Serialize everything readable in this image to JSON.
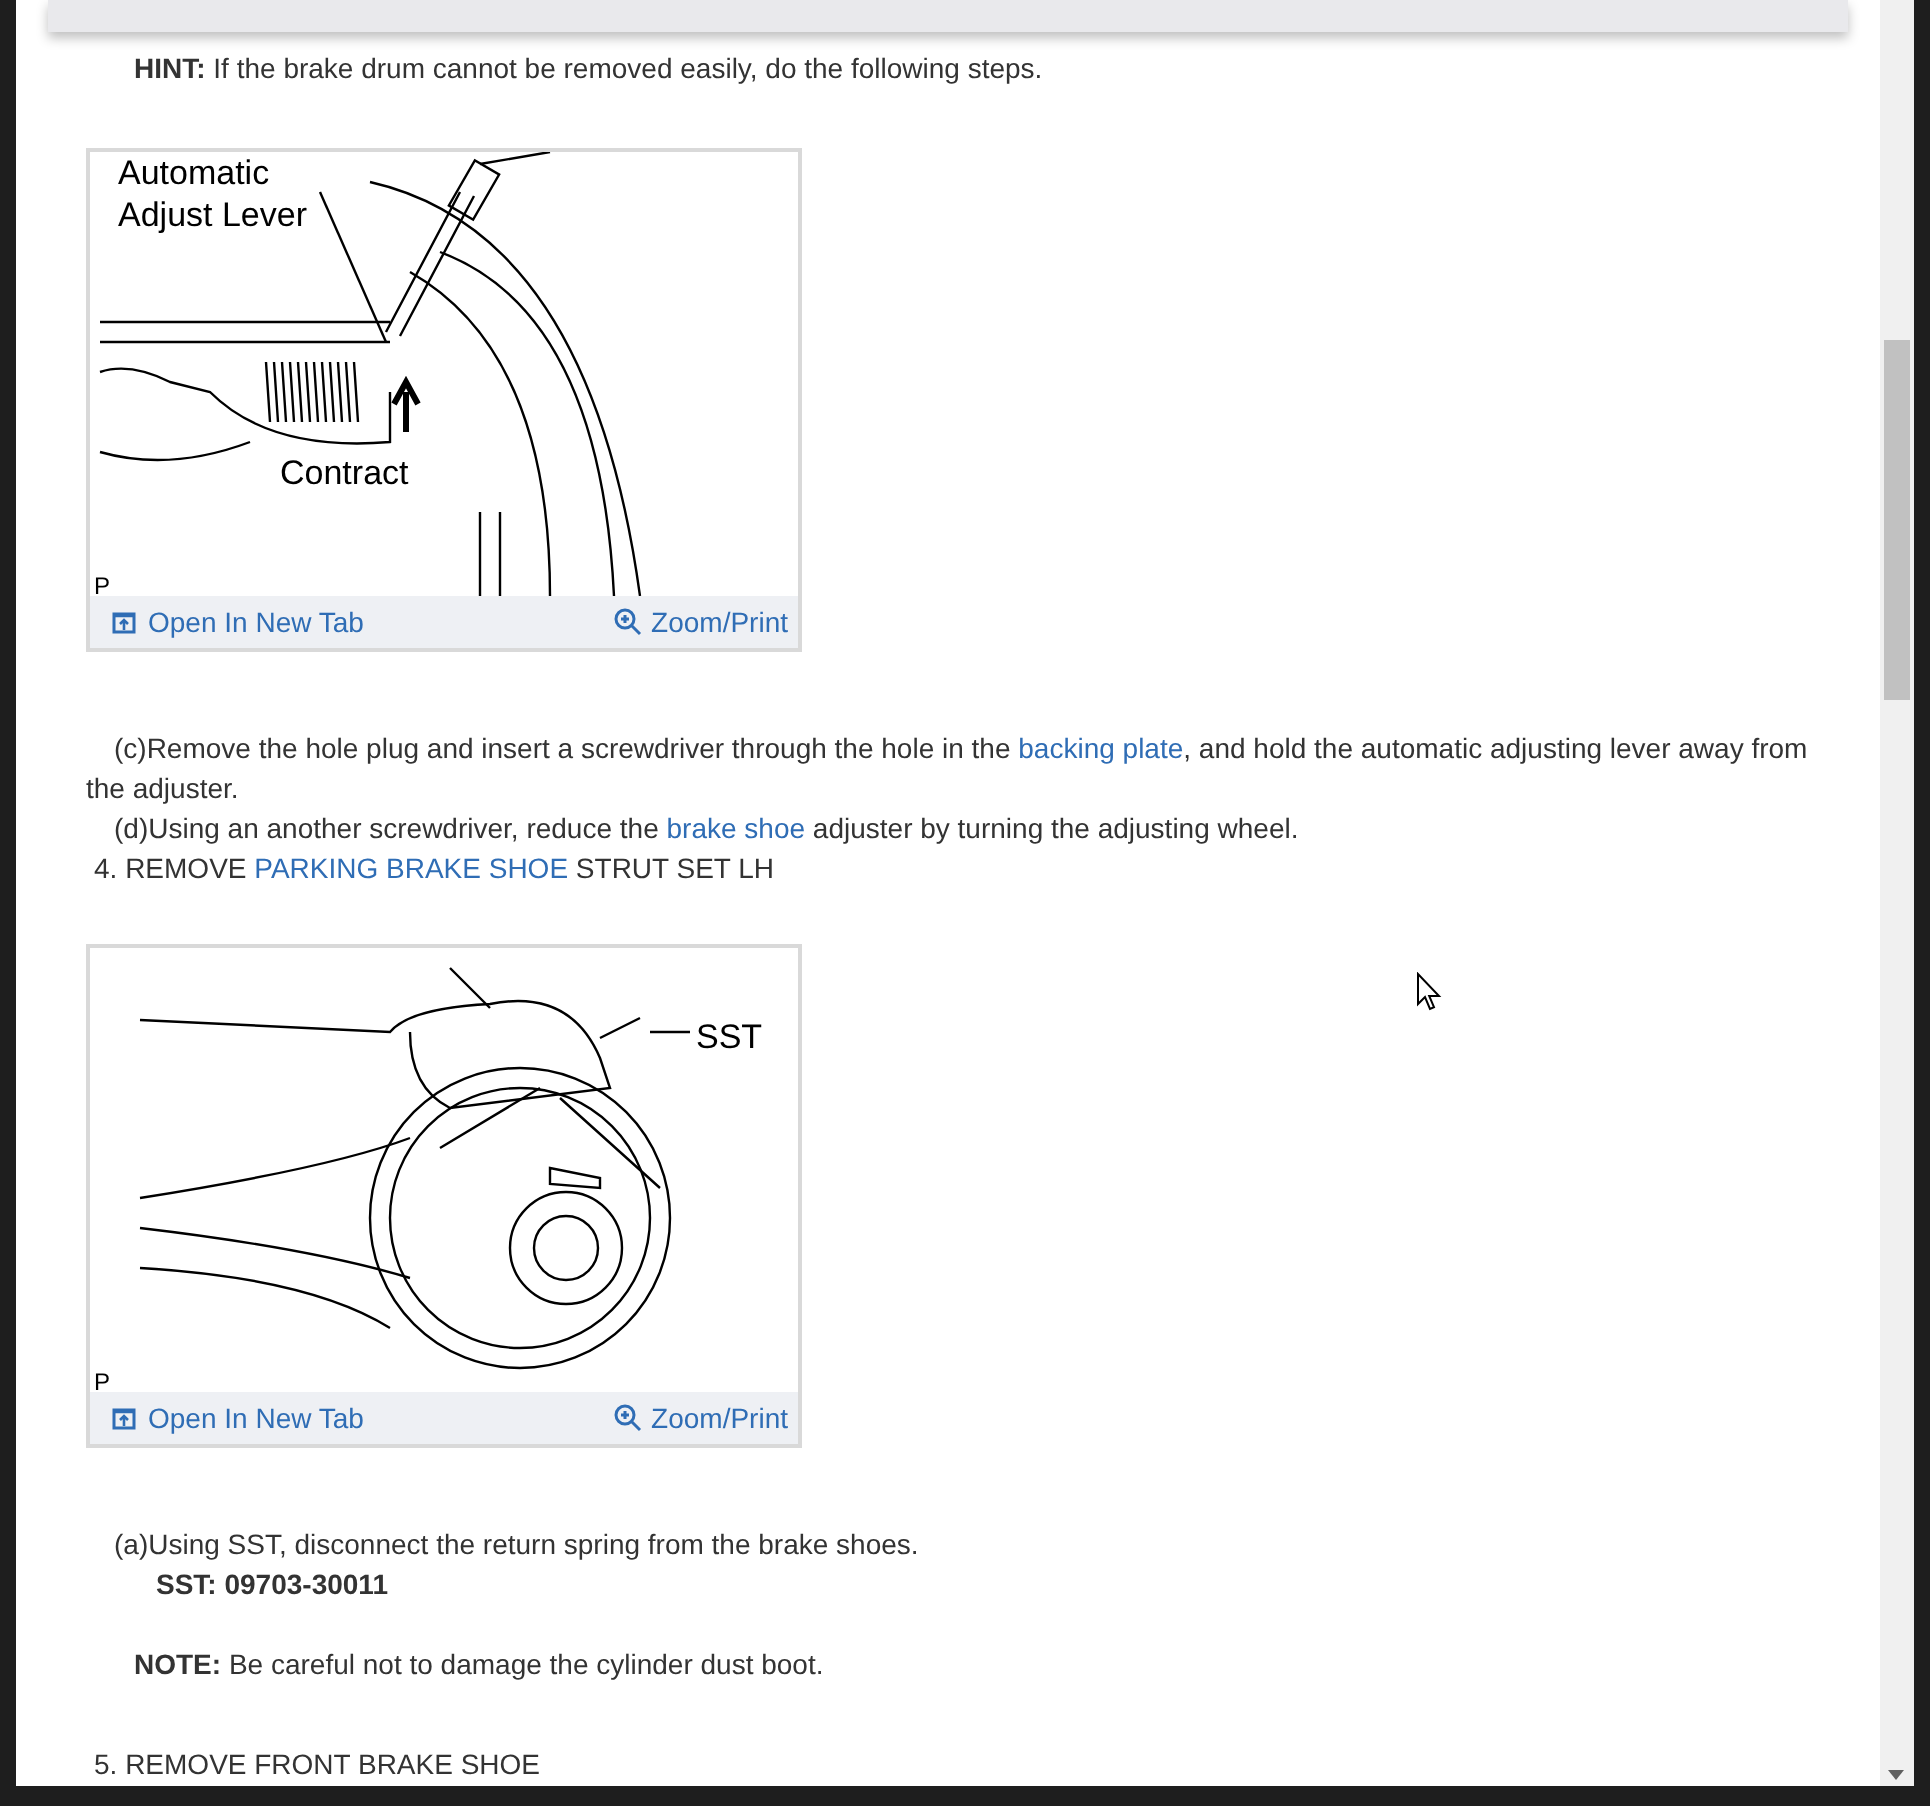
{
  "blocks": [
    {
      "kind": "note",
      "label": "HINT:",
      "parts": [
        {
          "text": " If the brake drum cannot be removed easily, do the following steps.",
          "link": false
        }
      ]
    },
    {
      "kind": "figure",
      "illustration": {
        "kind": "adjuster",
        "labels": [
          "Automatic",
          "Adjust Lever",
          "Contract",
          "P"
        ]
      },
      "links": [
        {
          "kind": "new_tab",
          "label": "Open In New Tab"
        },
        {
          "kind": "zoom",
          "label": "Zoom/Print"
        }
      ]
    },
    {
      "kind": "sub_step",
      "parts": [
        {
          "text": "(c)Remove the hole plug and insert a screwdriver through the hole in the ",
          "link": false
        },
        {
          "text": "backing plate",
          "link": true
        },
        {
          "text": ", and hold the automatic adjusting lever away from the adjuster.",
          "link": false
        }
      ]
    },
    {
      "kind": "sub_step",
      "parts": [
        {
          "text": "(d)Using an another screwdriver, reduce the ",
          "link": false
        },
        {
          "text": "brake shoe",
          "link": true
        },
        {
          "text": " adjuster by turning the adjusting wheel.",
          "link": false
        }
      ]
    },
    {
      "kind": "step",
      "parts": [
        {
          "text": "4. REMOVE ",
          "link": false
        },
        {
          "text": "PARKING BRAKE SHOE",
          "link": true
        },
        {
          "text": " STRUT SET LH",
          "link": false
        }
      ]
    },
    {
      "kind": "figure",
      "illustration": {
        "kind": "strut",
        "labels": [
          "SST",
          "P"
        ]
      },
      "links": [
        {
          "kind": "new_tab",
          "label": "Open In New Tab"
        },
        {
          "kind": "zoom",
          "label": "Zoom/Print"
        }
      ]
    },
    {
      "kind": "sub_step",
      "parts": [
        {
          "text": "(a)Using SST, disconnect the return spring from the brake shoes.",
          "link": false
        }
      ]
    },
    {
      "kind": "tool",
      "parts": [
        {
          "text": "SST: 09703-30011",
          "link": false
        }
      ]
    },
    {
      "kind": "note",
      "label": "NOTE:",
      "parts": [
        {
          "text": " Be careful not to damage the cylinder dust boot.",
          "link": false
        }
      ]
    },
    {
      "kind": "step",
      "parts": [
        {
          "text": "5. REMOVE FRONT BRAKE SHOE",
          "link": false
        }
      ]
    }
  ]
}
